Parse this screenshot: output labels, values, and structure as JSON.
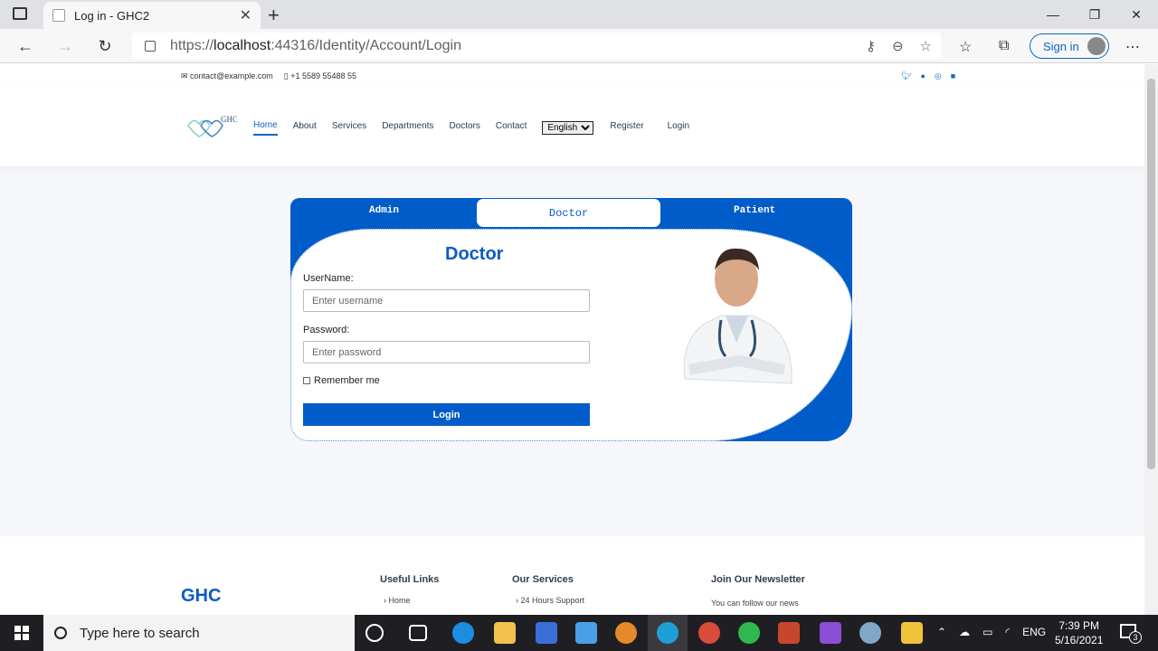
{
  "browser": {
    "tab_title": "Log in - GHC2",
    "url_prefix": "https://",
    "url_host": "localhost",
    "url_rest": ":44316/Identity/Account/Login",
    "signin_label": "Sign in"
  },
  "topbar": {
    "email": "contact@example.com",
    "phone": "+1 5589 55488 55"
  },
  "logo_text": "GHC",
  "nav": {
    "items": [
      "Home",
      "About",
      "Services",
      "Departments",
      "Doctors",
      "Contact"
    ],
    "language": "English",
    "register": "Register",
    "login": "Login"
  },
  "card": {
    "tabs": [
      "Admin",
      "Doctor",
      "Patient"
    ],
    "title": "Doctor",
    "username_label": "UserName:",
    "username_placeholder": "Enter username",
    "password_label": "Password:",
    "password_placeholder": "Enter password",
    "remember": "Remember me",
    "login_button": "Login"
  },
  "footer": {
    "brand": "GHC",
    "useful_links": "Useful Links",
    "link_home": "Home",
    "our_services": "Our Services",
    "service_1": "24 Hours Support",
    "newsletter": "Join Our Newsletter",
    "newsletter_text": "You can follow our news"
  },
  "taskbar": {
    "search_placeholder": "Type here to search",
    "language": "ENG",
    "time": "7:39 PM",
    "date": "5/16/2021",
    "notifications": "3"
  }
}
